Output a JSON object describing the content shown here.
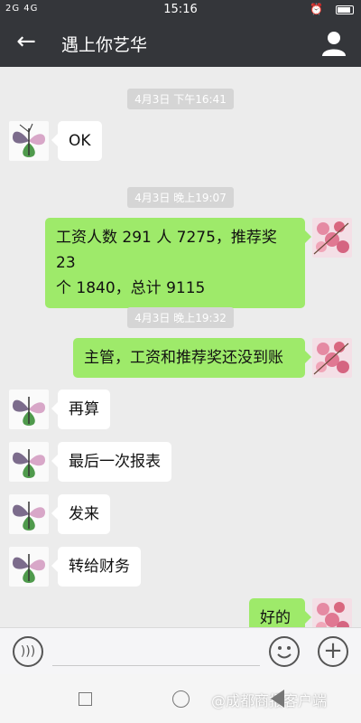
{
  "status": {
    "network": "2G 4G",
    "time": "15:16"
  },
  "header": {
    "title": "遇上你艺华"
  },
  "messages": [
    {
      "kind": "timestamp",
      "text": "4月3日 下午16:41"
    },
    {
      "kind": "in",
      "text": "OK"
    },
    {
      "kind": "timestamp",
      "text": "4月3日 晚上19:07"
    },
    {
      "kind": "out",
      "line1": "工资人数 291 人 7275，推荐奖 23",
      "line2": "个 1840，总计 9115"
    },
    {
      "kind": "timestamp",
      "text": "4月3日 晚上19:32"
    },
    {
      "kind": "out",
      "text": "主管，工资和推荐奖还没到账"
    },
    {
      "kind": "in",
      "text": "再算"
    },
    {
      "kind": "in",
      "text": "最后一次报表"
    },
    {
      "kind": "in",
      "text": "发来"
    },
    {
      "kind": "in",
      "text": "转给财务"
    },
    {
      "kind": "out",
      "text": "好的"
    }
  ],
  "watermark": "@成都商报客户端",
  "colors": {
    "outgoing_bubble": "#9eea6a",
    "header": "#34363a",
    "background": "#ececec"
  },
  "icons": {
    "back": "arrow-left-icon",
    "profile": "person-icon",
    "voice": "voice-icon",
    "emoji": "smiley-icon",
    "plus": "plus-icon"
  }
}
